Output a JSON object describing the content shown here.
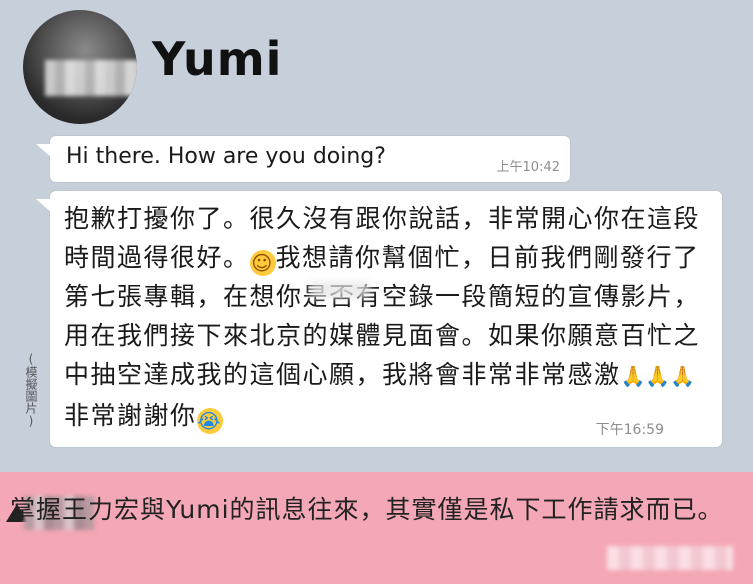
{
  "header": {
    "contact_name": "Yumi",
    "avatar": "blurred-profile-photo"
  },
  "messages": [
    {
      "text": "Hi there. How are you doing?",
      "time": "上午10:42"
    },
    {
      "text_part1": "抱歉打擾你了。很久沒有跟你說話，非常開心你在這段時間過得很好。",
      "emoji1": "smiling-face",
      "text_part2": "我想請你幫個忙，日前我們剛發行了第七張專輯，在想你是否有空錄一段簡短的宣傳影片，用在我們接下來北京的媒體見面會。如果你願意百忙之中抽空達成我的這個心願，我將會非常非常感激",
      "emoji2": "folded-hands",
      "text_part3": "非常謝謝你",
      "emoji3": "crying-face",
      "time": "下午16:59"
    }
  ],
  "side_note": "(模擬圖片)",
  "caption": {
    "text": "掌握王力宏與Yumi的訊息往來，其實僅是私下工作請求而已。"
  },
  "colors": {
    "chat_background": "#c7d0da",
    "bubble": "#ffffff",
    "caption_background": "#f4a7b6",
    "time_text": "#8e8e8e"
  }
}
